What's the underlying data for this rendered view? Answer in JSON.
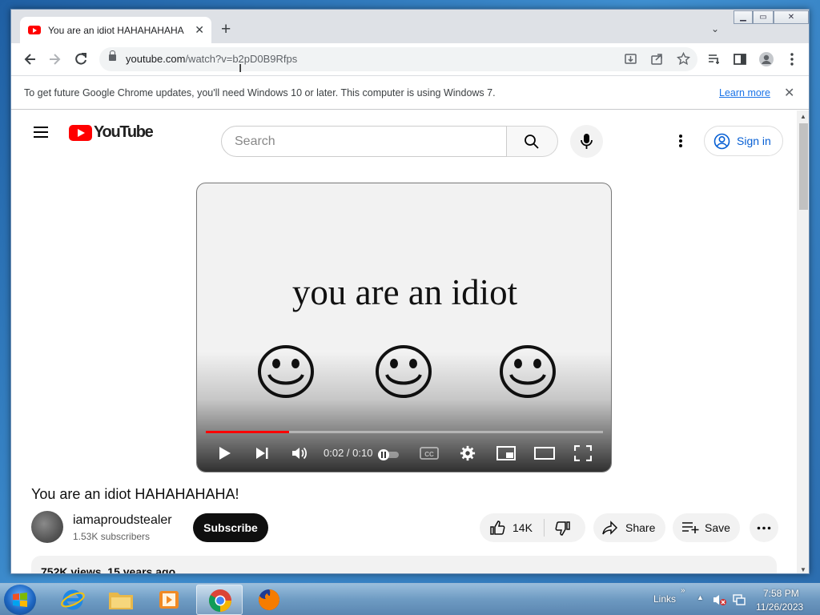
{
  "browser": {
    "tab_title": "You are an idiot HAHAHAHAHA!",
    "tab_close": "✕",
    "new_tab": "+",
    "url_host": "youtube.com",
    "url_path": "/watch?v=b2pD0B9Rfps",
    "window_controls": {
      "minimize": "▁",
      "maximize": "▭",
      "close": "✕"
    }
  },
  "infobar": {
    "message": "To get future Google Chrome updates, you'll need Windows 10 or later. This computer is using Windows 7.",
    "learn_more": "Learn more",
    "close": "✕"
  },
  "youtube": {
    "logo_text": "YouTube",
    "search_placeholder": "Search",
    "sign_in": "Sign in",
    "video": {
      "on_screen_text": "you are an idiot",
      "time": "0:02 / 0:10",
      "progress_fraction": 0.21
    },
    "title": "You are an idiot HAHAHAHAHA!",
    "channel": "iamaproudstealer",
    "subscribers": "1.53K subscribers",
    "subscribe": "Subscribe",
    "likes": "14K",
    "share": "Share",
    "save": "Save",
    "views": "752K views",
    "age": "15 years ago"
  },
  "taskbar": {
    "links_label": "Links",
    "time": "7:58 PM",
    "date": "11/26/2023"
  },
  "colors": {
    "accent": "#ff0000",
    "link": "#065fd4",
    "chrome_frame": "#dee1e6"
  },
  "icons": [
    "back-icon",
    "forward-icon",
    "reload-icon",
    "lock-icon",
    "install-icon",
    "share-icon",
    "star-icon",
    "reading-list-icon",
    "side-panel-icon",
    "profile-icon",
    "menu-icon",
    "search-icon",
    "mic-icon",
    "play-icon",
    "next-icon",
    "volume-icon",
    "cc-icon",
    "settings-icon",
    "miniplayer-icon",
    "theater-icon",
    "fullscreen-icon",
    "thumbs-up-icon",
    "thumbs-down-icon"
  ]
}
